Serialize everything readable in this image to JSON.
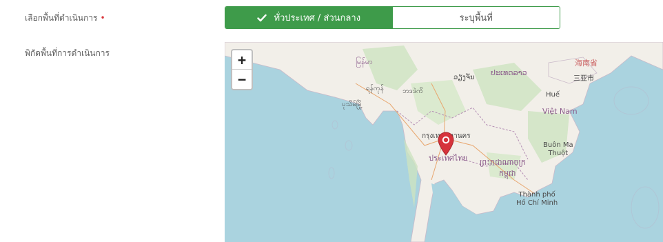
{
  "form": {
    "area_label": "เลือกพื้นที่ดำเนินการ",
    "required_mark": "•",
    "coord_label": "พิกัดพื้นที่การดำเนินการ"
  },
  "toggle": {
    "nationwide_label": "ทั่วประเทศ / ส่วนกลาง",
    "specific_label": "ระบุพื้นที่",
    "selected": "nationwide"
  },
  "map": {
    "zoom_in": "+",
    "zoom_out": "−",
    "labels": {
      "myanmar": "မြန်မာ",
      "yangon": "ရန်ကုန်",
      "naypyidaw": "ဘဒဒဲကိ",
      "bago": "ပုသိမ်မြို့",
      "laos_city": "ວຽງຈັນ",
      "laos": "ປະເທດລາວ",
      "hainan": "海南省",
      "sanya": "三亚市",
      "hue": "Huế",
      "vietnam": "Việt Nam",
      "bangkok": "กรุงเทพมหานคร",
      "thailand": "ประเทศไทย",
      "cambodia": "ព្រះរាជាណាចក្រ",
      "cambodia2": "កម្ពុជា",
      "buonma": "Buôn Ma\nThuột",
      "hcm": "Thành phố\nHồ Chí Minh"
    }
  },
  "colors": {
    "accent_green": "#3e9b4a",
    "required_red": "#d9343a",
    "marker_red": "#d6333b",
    "sea": "#aad3df",
    "land": "#f2efe9"
  }
}
